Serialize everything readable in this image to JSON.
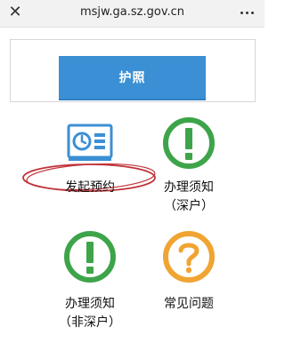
{
  "browser": {
    "close_glyph": "✕",
    "url": "msjw.ga.sz.gov.cn"
  },
  "tabs": [
    {
      "label": "护照",
      "active": true
    }
  ],
  "menu": {
    "book": {
      "label": "发起预约"
    },
    "guide_sz": {
      "label": "办理须知",
      "sublabel": "（深户）"
    },
    "guide_non_sz": {
      "label": "办理须知",
      "sublabel": "（非深户）"
    },
    "faq": {
      "label": "常见问题"
    }
  },
  "colors": {
    "accent_blue": "#3b8fd4",
    "green": "#3ea44a",
    "orange": "#f0a431",
    "annotation_red": "#c0333a"
  }
}
